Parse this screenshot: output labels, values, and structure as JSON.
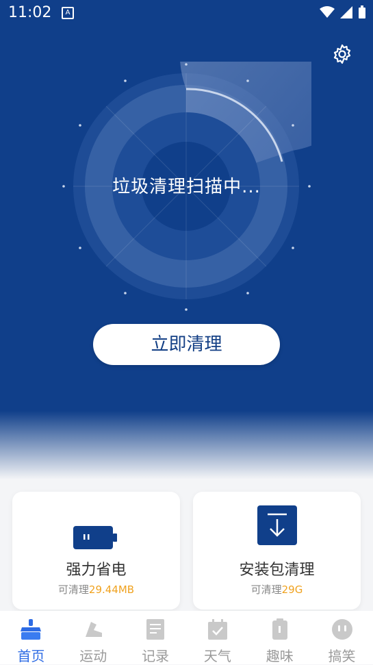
{
  "status_bar": {
    "time": "11:02",
    "app_icon": "A"
  },
  "icons": {
    "settings": "gear-icon"
  },
  "scanner": {
    "status_text": "垃圾清理扫描中..."
  },
  "clean_button": {
    "label": "立即清理"
  },
  "cards": [
    {
      "title": "强力省电",
      "sub_prefix": "可清理",
      "sub_value": "29.44MB",
      "icon": "battery-icon"
    },
    {
      "title": "安装包清理",
      "sub_prefix": "可清理",
      "sub_value": "29G",
      "icon": "download-icon"
    }
  ],
  "nav": [
    {
      "label": "首页",
      "icon": "broom-icon",
      "active": true
    },
    {
      "label": "运动",
      "icon": "shoe-icon",
      "active": false
    },
    {
      "label": "记录",
      "icon": "document-icon",
      "active": false
    },
    {
      "label": "天气",
      "icon": "calendar-check-icon",
      "active": false
    },
    {
      "label": "趣味",
      "icon": "clipboard-icon",
      "active": false
    },
    {
      "label": "搞笑",
      "icon": "face-icon",
      "active": false
    }
  ],
  "colors": {
    "primary": "#103f8a",
    "accent": "#f0a21f",
    "active_nav": "#2d6be4"
  }
}
